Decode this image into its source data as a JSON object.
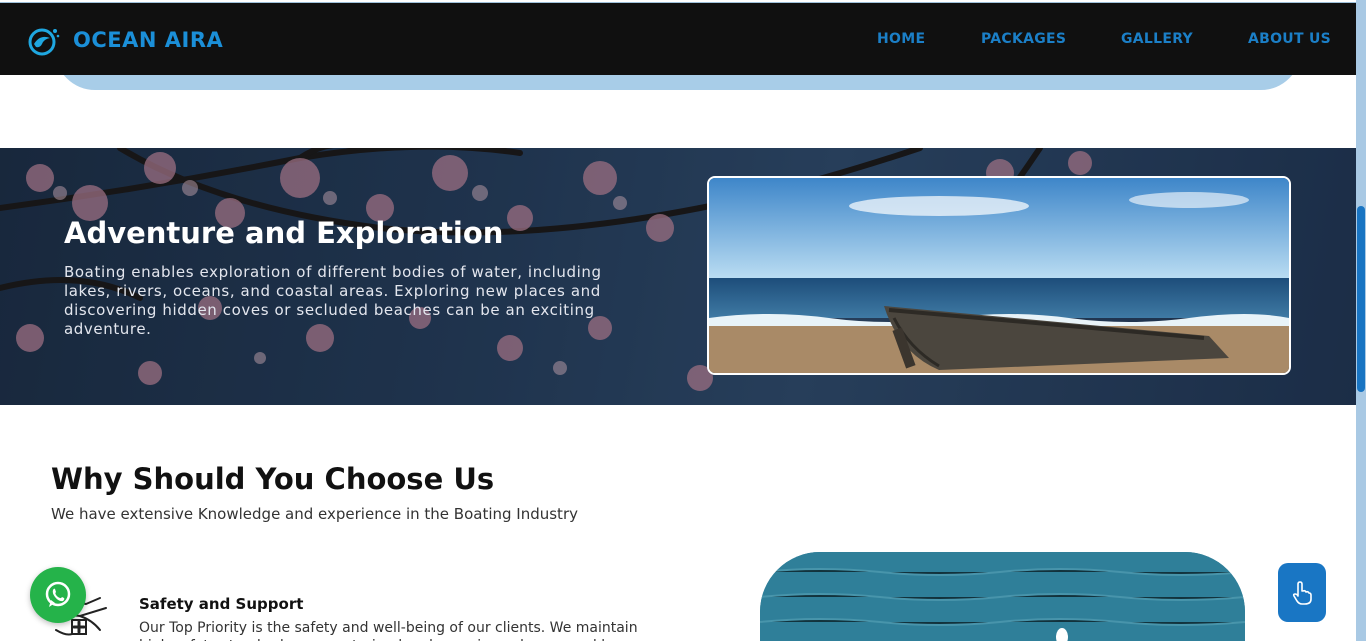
{
  "brand": {
    "name": "OCEAN AIRA",
    "logo_icon": "dolphin-wave-icon"
  },
  "nav": {
    "items": [
      "HOME",
      "PACKAGES",
      "GALLERY",
      "ABOUT US"
    ]
  },
  "adventure": {
    "title": "Adventure and Exploration",
    "text": "Boating enables exploration of different bodies of water, including lakes, rivers, oceans, and coastal areas. Exploring new places and discovering hidden coves or secluded beaches can be an exciting adventure."
  },
  "why": {
    "title": "Why Should You Choose Us",
    "subtitle": "We have extensive Knowledge and experience in the Boating Industry",
    "features": [
      {
        "title": "Safety and Support",
        "text": "Our Top Priority is the safety and well-being of our clients. We maintain high safety standards, ensure trained and experienced crew, and keep emergency support readily available during the trip.",
        "icon": "safety-support-icon"
      }
    ]
  },
  "floating": {
    "whatsapp_icon": "whatsapp-icon",
    "hand_icon": "hand-pointer-icon"
  },
  "colors": {
    "nav_bg": "#101010",
    "brand": "#1b8fd8",
    "whatsapp": "#25b34a",
    "accent": "#1976c4"
  }
}
